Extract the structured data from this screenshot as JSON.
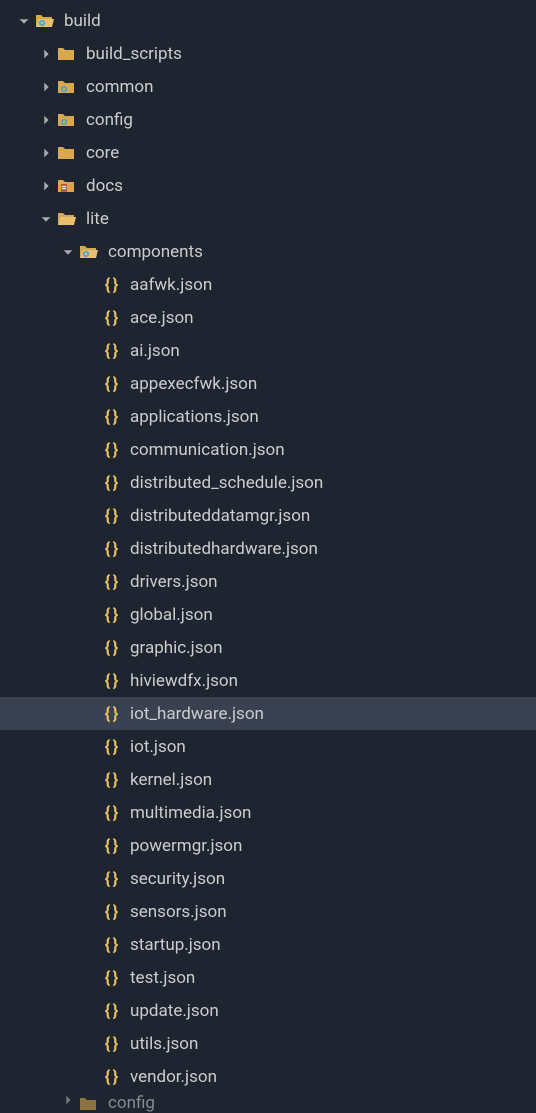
{
  "tree": {
    "root": {
      "name": "build",
      "expanded": true,
      "children": [
        {
          "name": "build_scripts",
          "type": "folder",
          "expanded": false
        },
        {
          "name": "common",
          "type": "folder",
          "expanded": false,
          "iconVariant": "gear"
        },
        {
          "name": "config",
          "type": "folder",
          "expanded": false,
          "iconVariant": "gear"
        },
        {
          "name": "core",
          "type": "folder",
          "expanded": false
        },
        {
          "name": "docs",
          "type": "folder",
          "expanded": false,
          "iconVariant": "docs"
        },
        {
          "name": "lite",
          "type": "folder",
          "expanded": true,
          "children": [
            {
              "name": "components",
              "type": "folder",
              "expanded": true,
              "iconVariant": "gear",
              "children": [
                {
                  "name": "aafwk.json",
                  "type": "json"
                },
                {
                  "name": "ace.json",
                  "type": "json"
                },
                {
                  "name": "ai.json",
                  "type": "json"
                },
                {
                  "name": "appexecfwk.json",
                  "type": "json"
                },
                {
                  "name": "applications.json",
                  "type": "json"
                },
                {
                  "name": "communication.json",
                  "type": "json"
                },
                {
                  "name": "distributed_schedule.json",
                  "type": "json"
                },
                {
                  "name": "distributeddatamgr.json",
                  "type": "json"
                },
                {
                  "name": "distributedhardware.json",
                  "type": "json"
                },
                {
                  "name": "drivers.json",
                  "type": "json"
                },
                {
                  "name": "global.json",
                  "type": "json"
                },
                {
                  "name": "graphic.json",
                  "type": "json"
                },
                {
                  "name": "hiviewdfx.json",
                  "type": "json"
                },
                {
                  "name": "iot_hardware.json",
                  "type": "json",
                  "selected": true
                },
                {
                  "name": "iot.json",
                  "type": "json"
                },
                {
                  "name": "kernel.json",
                  "type": "json"
                },
                {
                  "name": "multimedia.json",
                  "type": "json"
                },
                {
                  "name": "powermgr.json",
                  "type": "json"
                },
                {
                  "name": "security.json",
                  "type": "json"
                },
                {
                  "name": "sensors.json",
                  "type": "json"
                },
                {
                  "name": "startup.json",
                  "type": "json"
                },
                {
                  "name": "test.json",
                  "type": "json"
                },
                {
                  "name": "update.json",
                  "type": "json"
                },
                {
                  "name": "utils.json",
                  "type": "json"
                },
                {
                  "name": "vendor.json",
                  "type": "json"
                }
              ]
            },
            {
              "name": "config",
              "type": "folder",
              "expanded": false,
              "partial": true
            }
          ]
        }
      ]
    }
  }
}
